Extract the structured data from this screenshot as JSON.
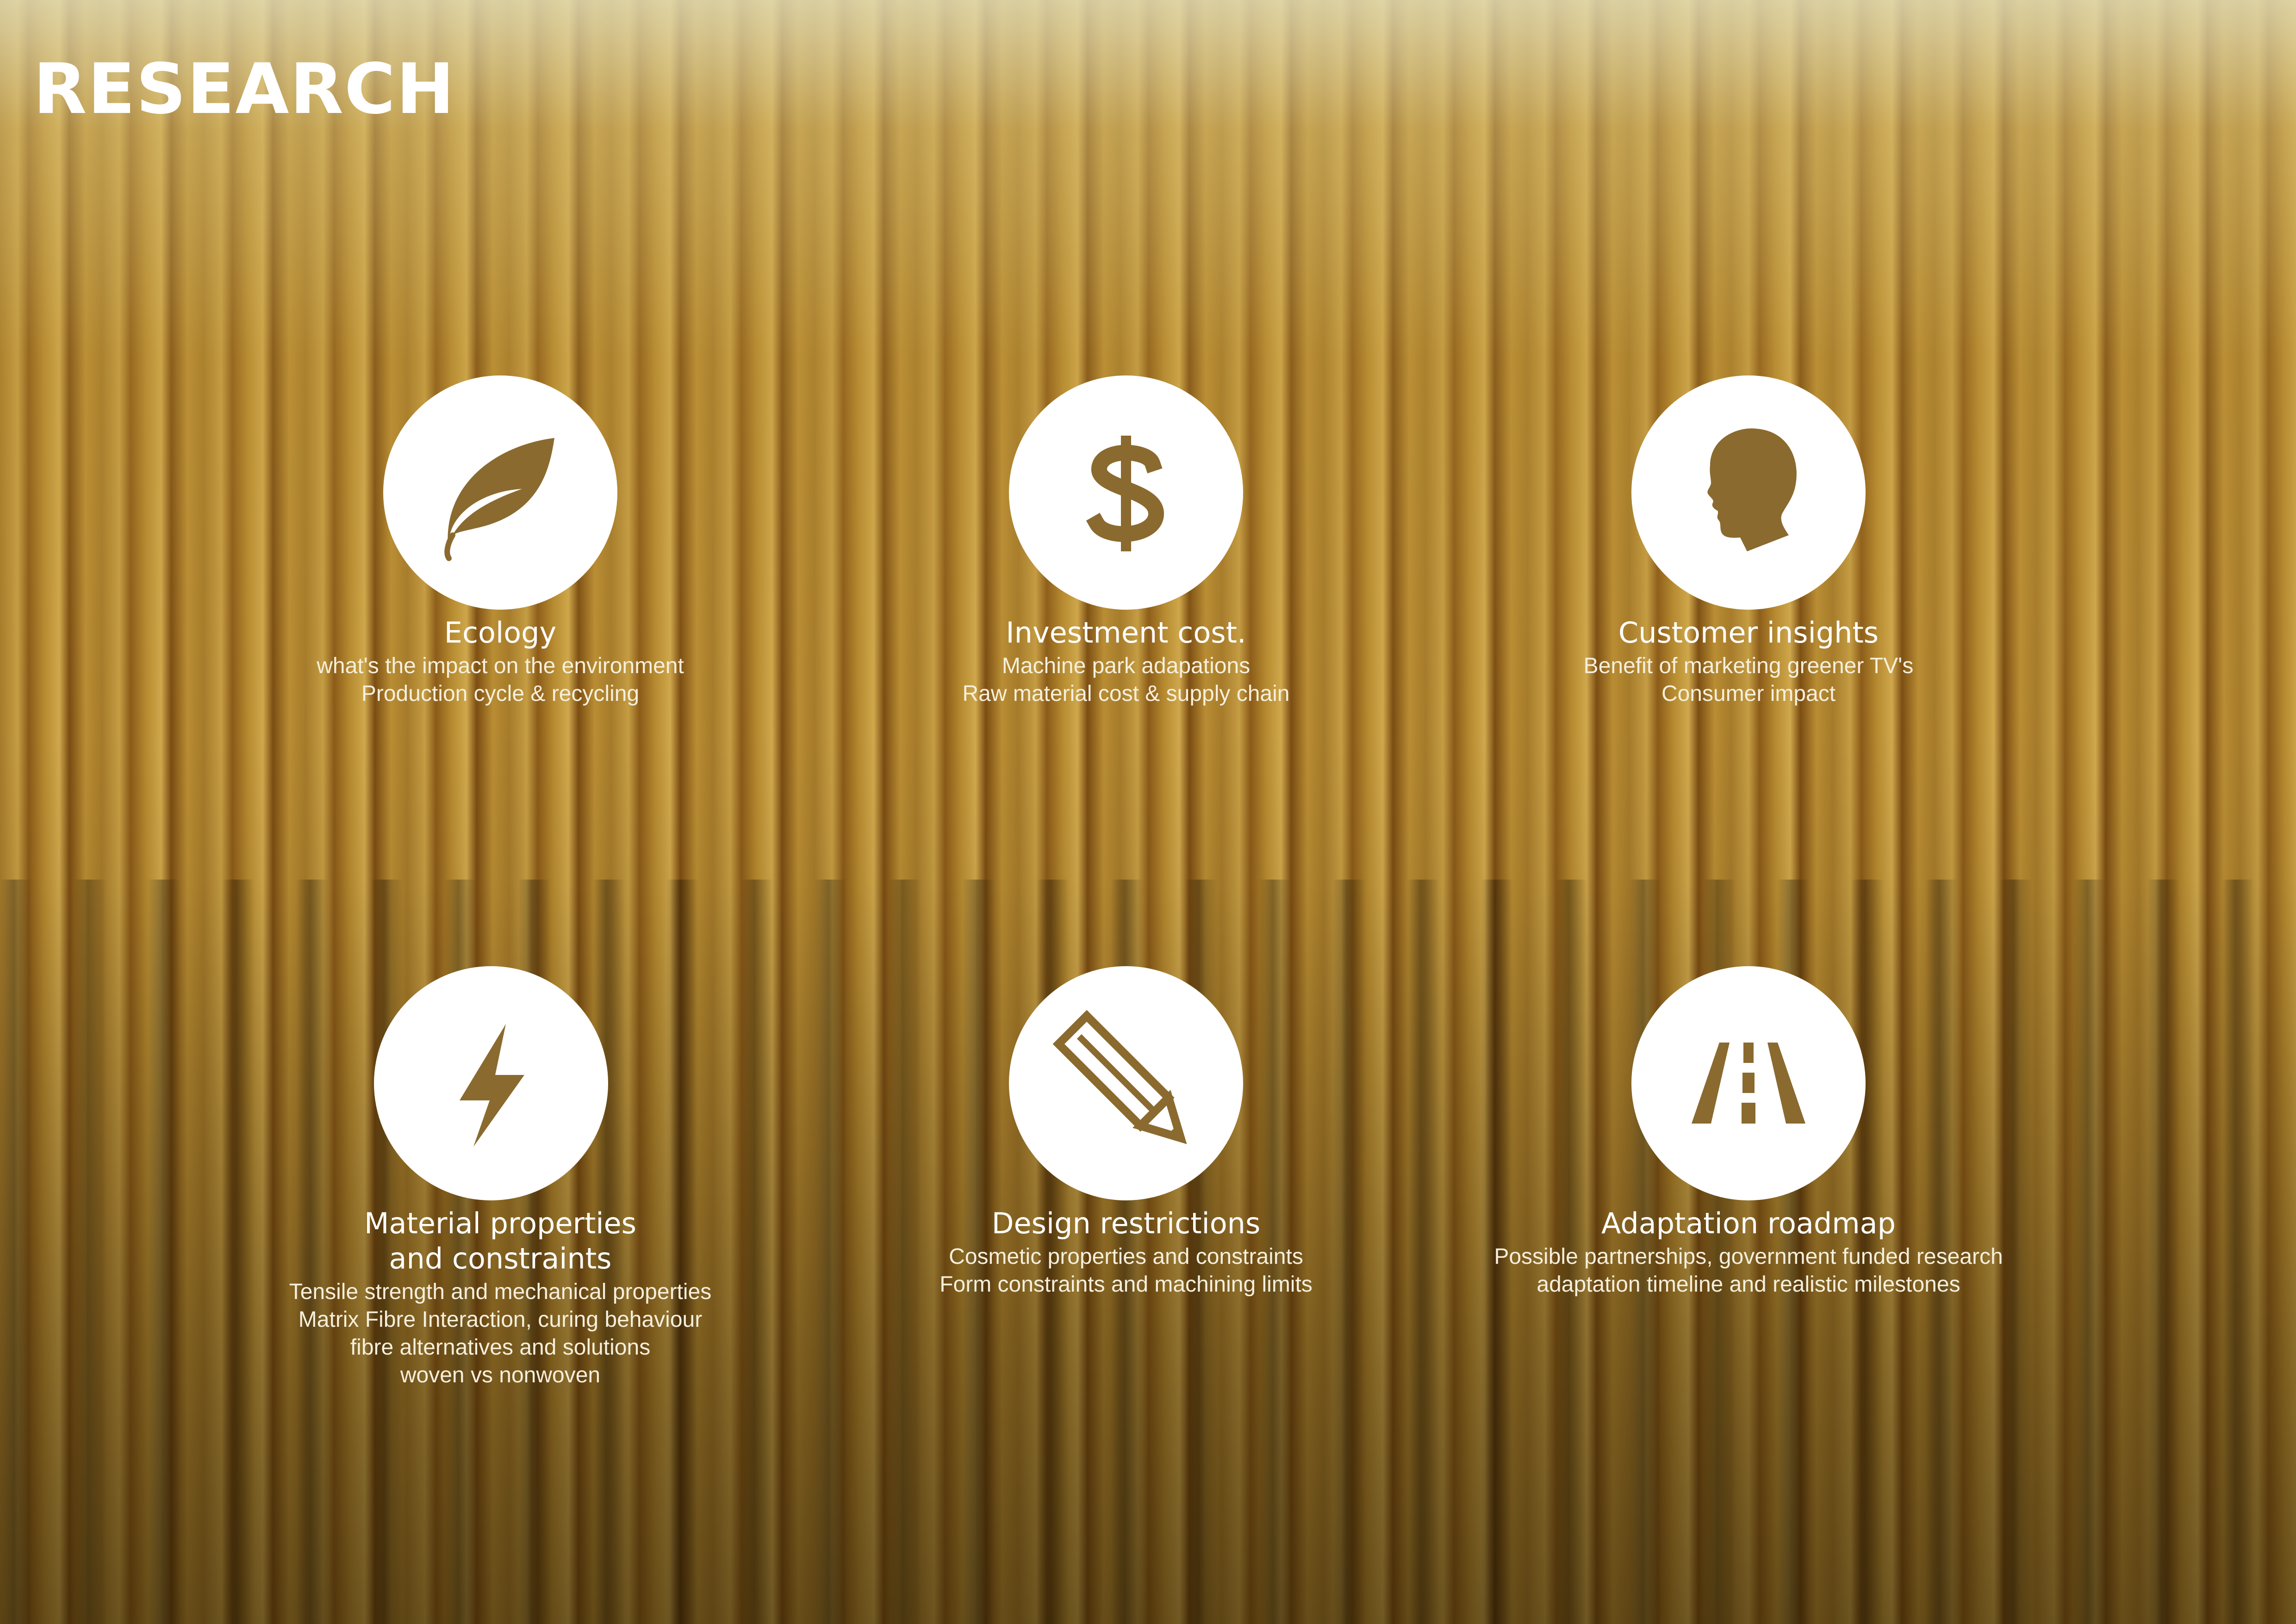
{
  "title": "RESEARCH",
  "colors": {
    "icon": "#8a6a2f",
    "circle": "#ffffff",
    "text": "#ffffff"
  },
  "items": [
    {
      "icon": "leaf-icon",
      "title": "Ecology",
      "lines": [
        "what's the impact on the environment",
        "Production cycle & recycling"
      ]
    },
    {
      "icon": "dollar-icon",
      "title": "Investment cost.",
      "lines": [
        "Machine park adapations",
        "Raw material cost & supply chain"
      ]
    },
    {
      "icon": "head-profile-icon",
      "title": "Customer insights",
      "lines": [
        "Benefit of marketing greener TV's",
        "Consumer impact"
      ]
    },
    {
      "icon": "lightning-icon",
      "title": "Material properties\nand constraints",
      "lines": [
        "Tensile strength and mechanical properties",
        "Matrix Fibre Interaction, curing behaviour",
        "fibre alternatives and solutions",
        "woven vs nonwoven"
      ]
    },
    {
      "icon": "pencil-icon",
      "title": "Design restrictions",
      "lines": [
        "Cosmetic properties and constraints",
        "Form constraints and machining limits"
      ]
    },
    {
      "icon": "road-icon",
      "title": "Adaptation roadmap",
      "lines": [
        "Possible partnerships, government funded research",
        "adaptation timeline and realistic milestones"
      ]
    }
  ]
}
